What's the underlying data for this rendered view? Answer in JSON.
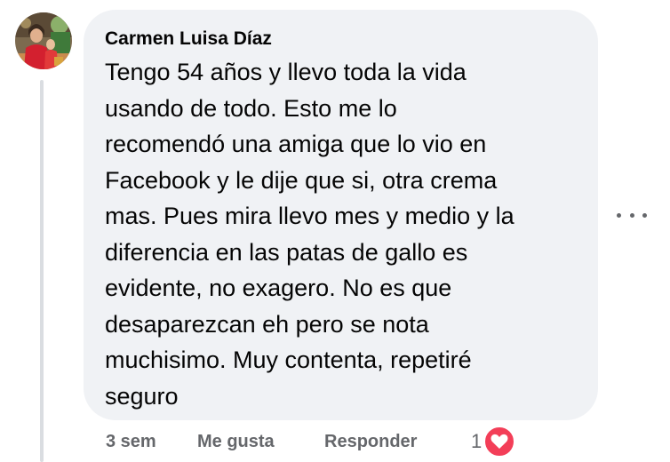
{
  "comment": {
    "author": "Carmen Luisa Díaz",
    "text": "Tengo 54 años y llevo toda la vida\nusando de todo. Esto me lo\nrecomendó una amiga que lo vio en\nFacebook y le dije que si, otra crema\nmas. Pues mira llevo mes y medio y la\ndiferencia en las patas de gallo es\nevidente, no exagero. No es que\ndesaparezcan eh pero se nota\nmuchisimo. Muy contenta, repetiré\nseguro",
    "avatar_icon": "profile-photo",
    "more_icon": "more-options-icon"
  },
  "actions": {
    "time": "3 sem",
    "like_label": "Me gusta",
    "reply_label": "Responder"
  },
  "reactions": {
    "count": "1",
    "icon": "heart-icon",
    "color": "#f33e58"
  },
  "colors": {
    "bubble": "#f0f2f5",
    "secondary_text": "#65676b",
    "primary_text": "#050505"
  }
}
